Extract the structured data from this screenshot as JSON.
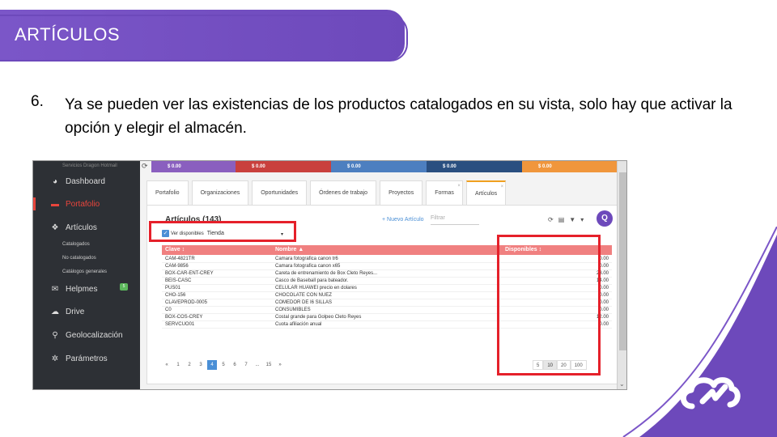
{
  "slide": {
    "title": "ARTÍCULOS",
    "step_number": "6.",
    "step_text": "Ya se pueden ver las existencias de los productos catalogados en su vista, solo hay que activar la opción y elegir el almacén."
  },
  "colors": {
    "banner": "#6d49bb",
    "highlight_box": "#e5202a",
    "table_header": "#f08080",
    "sidebar": "#2d3035"
  },
  "app": {
    "brand": "Servicios Dragon Hotmail",
    "sidebar": [
      {
        "label": "Dashboard",
        "icon": "dashboard-icon"
      },
      {
        "label": "Portafolio",
        "icon": "briefcase-icon"
      },
      {
        "label": "Artículos",
        "icon": "cubes-icon"
      },
      {
        "label": "Helpmes",
        "icon": "chat-icon",
        "badge": "5"
      },
      {
        "label": "Drive",
        "icon": "cloud-icon"
      },
      {
        "label": "Geolocalización",
        "icon": "map-marker-icon"
      },
      {
        "label": "Parámetros",
        "icon": "gear-icon"
      }
    ],
    "subitems": [
      "Catalogados",
      "No catalogados",
      "Catálogos generales"
    ],
    "kpis": [
      {
        "value": "$ 0.00",
        "color": "#8a5fbf"
      },
      {
        "value": "$ 0.00",
        "color": "#c9403d"
      },
      {
        "value": "$ 0.00",
        "color": "#4d7fc0"
      },
      {
        "value": "$ 0.00",
        "color": "#2a4f80"
      },
      {
        "value": "$ 0.00",
        "color": "#f0963c"
      }
    ],
    "tabs": [
      "Portafolio",
      "Organizaciones",
      "Oportunidades",
      "Órdenes de trabajo",
      "Proyectos",
      "Formas",
      "Artículos"
    ],
    "panel_title": "Artículos (143)",
    "new_article": "+ Nuevo Artículo",
    "filter_placeholder": "Filtrar",
    "avatar_letter": "Q",
    "checkbox_label": "Ver disponibles",
    "warehouse": "Tienda",
    "columns": [
      "Clave ↕",
      "Nombre ▲",
      "Disponibles ↕"
    ],
    "rows": [
      [
        "CAM-4821TR",
        "Camara fotografica canon tr6",
        "0.00"
      ],
      [
        "CAM-9856",
        "Camara fotografica canon x65",
        "0.00"
      ],
      [
        "BOX-CAR-ENT-CREY",
        "Careta de entrenamiento de Box Cleto Reyes...",
        "23.00"
      ],
      [
        "BEIS-CASC",
        "Casco de Baseball para bateador.",
        "14.00"
      ],
      [
        "PUS01",
        "CELULAR HUAWEI precio en dolares",
        "0.00"
      ],
      [
        "CHO-156",
        "CHOCOLATE CON NUEZ",
        "0.00"
      ],
      [
        "CLAVEPROD-0005",
        "COMEDOR DE I6 SILLAS",
        "0.00"
      ],
      [
        "C0",
        "CONSUMIBLES",
        "0.00"
      ],
      [
        "BOX-COS-CREY",
        "Costal grande para Golpeo Cleto Reyes",
        "12.00"
      ],
      [
        "SERVCUO01",
        "Cuota afiliación anual",
        "0.00"
      ]
    ],
    "pages": [
      "«",
      "1",
      "2",
      "3",
      "4",
      "5",
      "6",
      "7",
      "...",
      "15",
      "»"
    ],
    "current_page": "4",
    "page_sizes": [
      "5",
      "10",
      "20",
      "100"
    ],
    "current_size": "10"
  }
}
